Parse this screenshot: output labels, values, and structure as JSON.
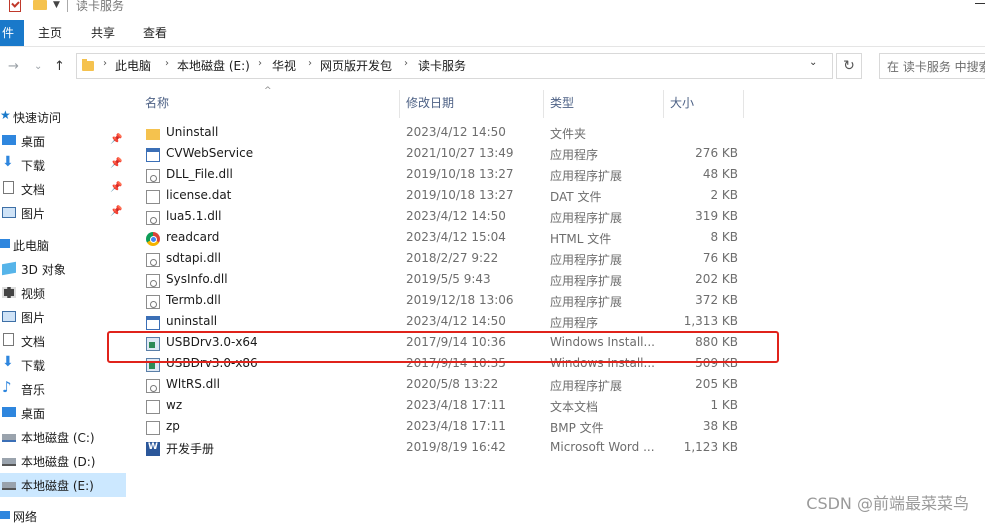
{
  "window": {
    "title": "读卡服务"
  },
  "ribbon": {
    "tabs": [
      "件",
      "主页",
      "共享",
      "查看"
    ]
  },
  "address": {
    "breadcrumbs": [
      "此电脑",
      "本地磁盘 (E:)",
      "华视",
      "网页版开发包",
      "读卡服务"
    ],
    "search_placeholder": "在 读卡服务 中搜索"
  },
  "nav_pane": {
    "items": [
      {
        "label": "快速访问",
        "icon": "star-icon",
        "pinned": false
      },
      {
        "label": "桌面",
        "icon": "desktop-icon",
        "pinned": true
      },
      {
        "label": "下载",
        "icon": "download-icon",
        "pinned": true
      },
      {
        "label": "文档",
        "icon": "document-icon",
        "pinned": true
      },
      {
        "label": "图片",
        "icon": "picture-icon",
        "pinned": true
      },
      {
        "label": "此电脑",
        "icon": "computer-icon",
        "pinned": false
      },
      {
        "label": "3D 对象",
        "icon": "cube-icon",
        "pinned": false
      },
      {
        "label": "视频",
        "icon": "video-icon",
        "pinned": false
      },
      {
        "label": "图片",
        "icon": "picture-icon",
        "pinned": false
      },
      {
        "label": "文档",
        "icon": "document-icon",
        "pinned": false
      },
      {
        "label": "下载",
        "icon": "download-icon",
        "pinned": false
      },
      {
        "label": "音乐",
        "icon": "music-icon",
        "pinned": false
      },
      {
        "label": "桌面",
        "icon": "desktop-icon",
        "pinned": false
      },
      {
        "label": "本地磁盘 (C:)",
        "icon": "drive-icon",
        "pinned": false
      },
      {
        "label": "本地磁盘 (D:)",
        "icon": "drive-icon",
        "pinned": false
      },
      {
        "label": "本地磁盘 (E:)",
        "icon": "drive-icon",
        "pinned": false,
        "selected": true
      },
      {
        "label": "网络",
        "icon": "network-icon",
        "pinned": false
      }
    ]
  },
  "file_list": {
    "columns": [
      "名称",
      "修改日期",
      "类型",
      "大小"
    ],
    "rows": [
      {
        "name": "Uninstall",
        "date": "2023/4/12 14:50",
        "type": "文件夹",
        "size": "",
        "icon": "folder-icon"
      },
      {
        "name": "CVWebService",
        "date": "2021/10/27 13:49",
        "type": "应用程序",
        "size": "276 KB",
        "icon": "app-icon"
      },
      {
        "name": "DLL_File.dll",
        "date": "2019/10/18 13:27",
        "type": "应用程序扩展",
        "size": "48 KB",
        "icon": "dll-icon"
      },
      {
        "name": "license.dat",
        "date": "2019/10/18 13:27",
        "type": "DAT 文件",
        "size": "2 KB",
        "icon": "file-icon"
      },
      {
        "name": "lua5.1.dll",
        "date": "2023/4/12 14:50",
        "type": "应用程序扩展",
        "size": "319 KB",
        "icon": "dll-icon"
      },
      {
        "name": "readcard",
        "date": "2023/4/12 15:04",
        "type": "HTML 文件",
        "size": "8 KB",
        "icon": "chrome-icon"
      },
      {
        "name": "sdtapi.dll",
        "date": "2018/2/27 9:22",
        "type": "应用程序扩展",
        "size": "76 KB",
        "icon": "dll-icon"
      },
      {
        "name": "SysInfo.dll",
        "date": "2019/5/5 9:43",
        "type": "应用程序扩展",
        "size": "202 KB",
        "icon": "dll-icon"
      },
      {
        "name": "Termb.dll",
        "date": "2019/12/18 13:06",
        "type": "应用程序扩展",
        "size": "372 KB",
        "icon": "dll-icon"
      },
      {
        "name": "uninstall",
        "date": "2023/4/12 14:50",
        "type": "应用程序",
        "size": "1,313 KB",
        "icon": "app-icon"
      },
      {
        "name": "USBDrv3.0-x64",
        "date": "2017/9/14 10:36",
        "type": "Windows Install...",
        "size": "880 KB",
        "icon": "installer-icon"
      },
      {
        "name": "USBDrv3.0-x86",
        "date": "2017/9/14 10:35",
        "type": "Windows Install...",
        "size": "509 KB",
        "icon": "installer-icon"
      },
      {
        "name": "WltRS.dll",
        "date": "2020/5/8 13:22",
        "type": "应用程序扩展",
        "size": "205 KB",
        "icon": "dll-icon"
      },
      {
        "name": "wz",
        "date": "2023/4/18 17:11",
        "type": "文本文档",
        "size": "1 KB",
        "icon": "text-file-icon"
      },
      {
        "name": "zp",
        "date": "2023/4/18 17:11",
        "type": "BMP 文件",
        "size": "38 KB",
        "icon": "image-file-icon"
      },
      {
        "name": "开发手册",
        "date": "2019/8/19 16:42",
        "type": "Microsoft Word ...",
        "size": "1,123 KB",
        "icon": "word-icon"
      }
    ]
  },
  "watermark": "CSDN @前端最菜菜鸟",
  "colors": {
    "accent": "#1979ca",
    "selection": "#cce8ff",
    "highlight_box": "#e0231b"
  }
}
